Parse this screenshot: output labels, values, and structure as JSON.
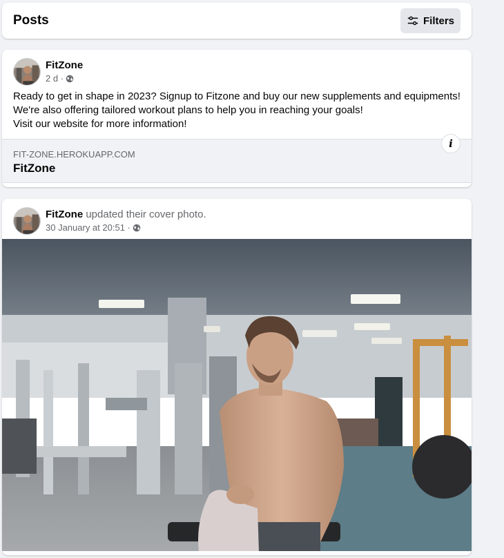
{
  "header": {
    "title": "Posts",
    "filters_label": "Filters"
  },
  "post1": {
    "author": "FitZone",
    "time": "2 d ·",
    "text_lines": [
      "Ready to get in shape in 2023? Signup to Fitzone and buy our new supplements and equipments!",
      "We're also offering tailored workout plans to help you in reaching your goals!",
      "Visit our website for more information!"
    ],
    "link": {
      "domain": "FIT-ZONE.HEROKUAPP.COM",
      "title": "FitZone"
    },
    "info_icon": "i"
  },
  "post2": {
    "author": "FitZone",
    "action": " updated their cover photo.",
    "time": "30 January at 20:51 ·"
  },
  "icons": {
    "filters": "sliders-icon",
    "privacy": "globe-icon",
    "info": "info-icon"
  }
}
